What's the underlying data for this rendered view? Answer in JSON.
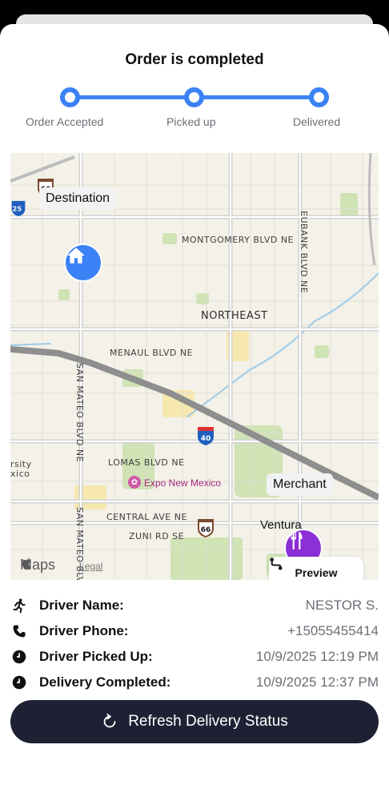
{
  "header": {
    "title": "Order is completed"
  },
  "progress": {
    "steps": [
      {
        "label": "Order Accepted",
        "done": true
      },
      {
        "label": "Picked up",
        "done": true
      },
      {
        "label": "Delivered",
        "done": true
      }
    ],
    "accent": "#3b82f6"
  },
  "map": {
    "destination_label": "Destination",
    "merchant_label": "Merchant",
    "merchant_sublabel": "Ventura",
    "area_label": "NORTHEAST",
    "poi_label": "Expo New Mexico",
    "streets": {
      "montgomery": "MONTGOMERY BLVD NE",
      "menaul": "MENAUL BLVD NE",
      "lomas": "LOMAS BLVD NE",
      "central": "CENTRAL AVE NE",
      "zuni": "ZUNI RD SE",
      "san_mateo_1": "SAN MATEO BLVD NE",
      "san_mateo_2": "SAN MATEO BLVD NE",
      "eubank": "EUBANK BLVD NE",
      "partial_left_1": "rsity",
      "partial_left_2": "xico"
    },
    "route_shields": [
      "66",
      "25",
      "40",
      "66",
      "66"
    ],
    "preview_label": "Preview",
    "brand": "Maps",
    "legal": "Legal"
  },
  "driver": {
    "name_label": "Driver Name:",
    "name_value": "NESTOR S.",
    "phone_label": "Driver Phone:",
    "phone_value": "+15055455414",
    "picked_label": "Driver Picked Up:",
    "picked_value": "10/9/2025 12:19 PM",
    "completed_label": "Delivery Completed:",
    "completed_value": "10/9/2025 12:37 PM"
  },
  "actions": {
    "refresh_label": "Refresh Delivery Status"
  },
  "colors": {
    "button_bg": "#1e2133",
    "home_pin": "#3b82f6",
    "merchant_pin": "#8b2fd6",
    "poi": "#a3287c"
  }
}
